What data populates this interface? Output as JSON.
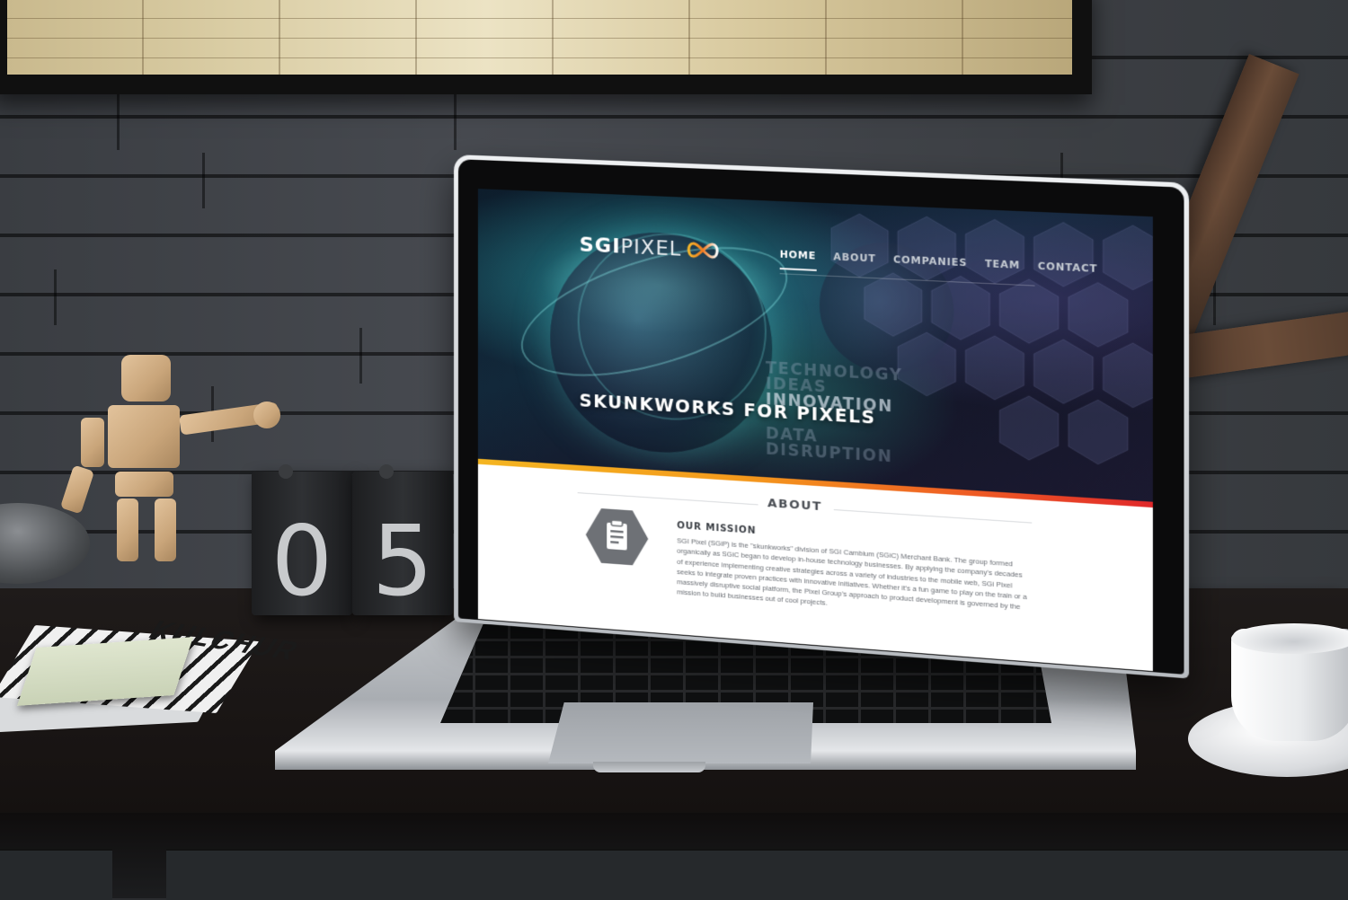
{
  "site": {
    "logo": {
      "sgi": "SGI",
      "pixel": "PIXEL"
    },
    "nav": [
      {
        "label": "HOME",
        "active": true
      },
      {
        "label": "ABOUT",
        "active": false
      },
      {
        "label": "COMPANIES",
        "active": false
      },
      {
        "label": "TEAM",
        "active": false
      },
      {
        "label": "CONTACT",
        "active": false
      }
    ],
    "hero": {
      "tagline": "SKUNKWORKS FOR PIXELS",
      "words": [
        "TECHNOLOGY",
        "IDEAS",
        "INNOVATION",
        "DATA",
        "DISRUPTION"
      ]
    },
    "about": {
      "section_title": "ABOUT",
      "mission_title": "OUR MISSION",
      "mission_body": "SGI Pixel (SGiP) is the \"skunkworks\" division of SGI Cambium (SGiC) Merchant Bank. The group formed organically as SGiC began to develop in-house technology businesses. By applying the company's decades of experience implementing creative strategies across a variety of industries to the mobile web, SGi Pixel seeks to integrate proven practices with innovative initiatives. Whether it's a fun game to play on the train or a massively disruptive social platform, the Pixel Group's approach to product development is governed by the mission to build businesses out of cool projects.",
      "icon": "clipboard-icon"
    },
    "colors": {
      "accent_start": "#f4b521",
      "accent_end": "#e0282a",
      "hex_icon": "#6e7176"
    }
  },
  "scene": {
    "calendar": [
      "0",
      "5"
    ],
    "magazine_title": "KULCHUR"
  }
}
